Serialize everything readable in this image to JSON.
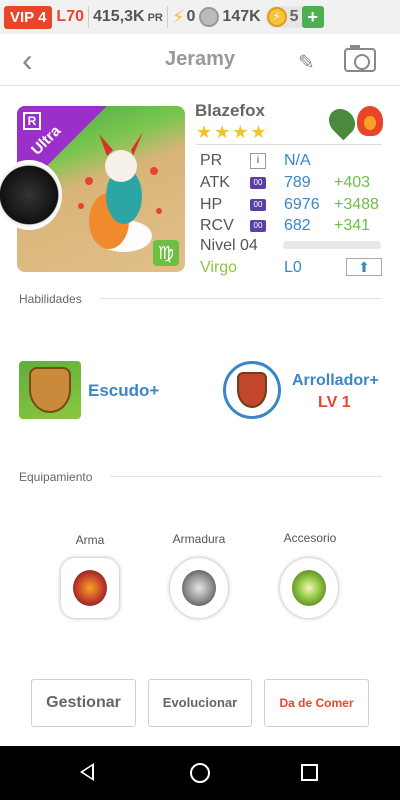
{
  "status": {
    "vip": "VIP 4",
    "level": "L70",
    "power": "415,3K",
    "power_unit": "PR",
    "energy": "0",
    "coins": "147K",
    "gems": "5",
    "plus": "+"
  },
  "header": {
    "title": "Jeramy"
  },
  "monster": {
    "name": "Blazefox",
    "stars": "★★★★",
    "rarity_letter": "R",
    "rarity": "Ultra",
    "zodiac_symbol": "♍",
    "stats": {
      "pr_label": "PR",
      "pr_box": "i",
      "pr_value": "N/A",
      "atk_label": "ATK",
      "atk_badge": "00",
      "atk_value": "789",
      "atk_bonus": "+403",
      "hp_label": "HP",
      "hp_badge": "00",
      "hp_value": "6976",
      "hp_bonus": "+3488",
      "rcv_label": "RCV",
      "rcv_badge": "00",
      "rcv_value": "682",
      "rcv_bonus": "+341",
      "nivel_label": "Nivel 04",
      "nivel_progress": 0,
      "zodiac": "Virgo",
      "upgrade_level": "L0"
    },
    "elements": [
      "leaf-icon",
      "fire-icon"
    ]
  },
  "sections": {
    "skills_title": "Habilidades",
    "equipment_title": "Equipamiento"
  },
  "skills": [
    {
      "name": "Escudo+"
    },
    {
      "name": "Arrollador+",
      "level": "LV 1"
    }
  ],
  "equipment": [
    {
      "label": "Arma"
    },
    {
      "label": "Armadura"
    },
    {
      "label": "Accesorio"
    }
  ],
  "buttons": {
    "manage": "Gestionar",
    "evolve": "Evolucionar",
    "feed": "Da de Comer"
  },
  "colors": {
    "accent_blue": "#3a86c8",
    "bonus_green": "#6cbe45",
    "feed_red": "#e8452a",
    "vip_red": "#e8452a"
  }
}
